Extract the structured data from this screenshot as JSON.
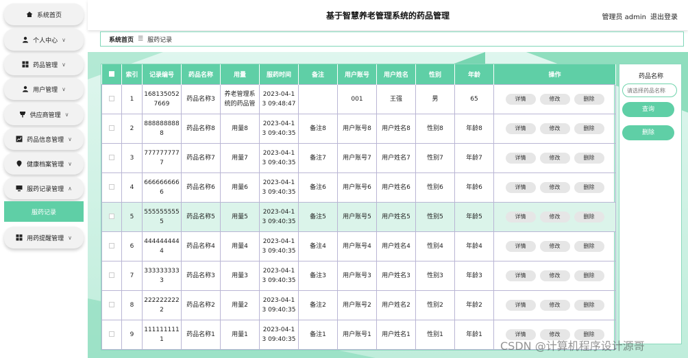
{
  "header": {
    "title": "基于智慧养老管理系统的药品管理",
    "user": "管理员 admin",
    "logout": "退出登录"
  },
  "breadcrumb": {
    "home": "系统首页",
    "separator": "☰",
    "current": "服药记录"
  },
  "sidebar": {
    "items": [
      {
        "label": "系统首页",
        "icon": "home-icon",
        "chevron": ""
      },
      {
        "label": "个人中心",
        "icon": "person-icon",
        "chevron": "∨"
      },
      {
        "label": "药品管理",
        "icon": "grid-icon",
        "chevron": "∨"
      },
      {
        "label": "用户管理",
        "icon": "person-icon",
        "chevron": "∨"
      },
      {
        "label": "供应商管理",
        "icon": "pin-icon",
        "chevron": "∨"
      },
      {
        "label": "药品信息管理",
        "icon": "chart-icon",
        "chevron": "∨"
      },
      {
        "label": "健康档案管理",
        "icon": "location-icon",
        "chevron": "∨"
      },
      {
        "label": "服药记录管理",
        "icon": "monitor-icon",
        "chevron": "∧"
      },
      {
        "label": "用药提醒管理",
        "icon": "grid-icon",
        "chevron": "∨"
      }
    ],
    "sub_item": "服药记录"
  },
  "table": {
    "headers": [
      "索引",
      "记录编号",
      "药品名称",
      "用量",
      "服药时间",
      "备注",
      "用户账号",
      "用户姓名",
      "性别",
      "年龄",
      "操作"
    ],
    "actions": {
      "detail": "详情",
      "edit": "修改",
      "delete": "删除"
    },
    "rows": [
      {
        "index": "1",
        "record_no": "1681350527669",
        "drug": "药品名称3",
        "dosage": "养老管理系统的药品管",
        "time": "2023-04-13 09:48:47",
        "note": "",
        "account": "001",
        "name": "王强",
        "gender": "男",
        "age": "65"
      },
      {
        "index": "2",
        "record_no": "8888888888",
        "drug": "药品名称8",
        "dosage": "用量8",
        "time": "2023-04-13 09:40:35",
        "note": "备注8",
        "account": "用户账号8",
        "name": "用户姓名8",
        "gender": "性别8",
        "age": "年龄8"
      },
      {
        "index": "3",
        "record_no": "7777777777",
        "drug": "药品名称7",
        "dosage": "用量7",
        "time": "2023-04-13 09:40:35",
        "note": "备注7",
        "account": "用户账号7",
        "name": "用户姓名7",
        "gender": "性别7",
        "age": "年龄7"
      },
      {
        "index": "4",
        "record_no": "6666666666",
        "drug": "药品名称6",
        "dosage": "用量6",
        "time": "2023-04-13 09:40:35",
        "note": "备注6",
        "account": "用户账号6",
        "name": "用户姓名6",
        "gender": "性别6",
        "age": "年龄6"
      },
      {
        "index": "5",
        "record_no": "5555555555",
        "drug": "药品名称5",
        "dosage": "用量5",
        "time": "2023-04-13 09:40:35",
        "note": "备注5",
        "account": "用户账号5",
        "name": "用户姓名5",
        "gender": "性别5",
        "age": "年龄5"
      },
      {
        "index": "6",
        "record_no": "4444444444",
        "drug": "药品名称4",
        "dosage": "用量4",
        "time": "2023-04-13 09:40:35",
        "note": "备注4",
        "account": "用户账号4",
        "name": "用户姓名4",
        "gender": "性别4",
        "age": "年龄4"
      },
      {
        "index": "7",
        "record_no": "3333333333",
        "drug": "药品名称3",
        "dosage": "用量3",
        "time": "2023-04-13 09:40:35",
        "note": "备注3",
        "account": "用户账号3",
        "name": "用户姓名3",
        "gender": "性别3",
        "age": "年龄3"
      },
      {
        "index": "8",
        "record_no": "2222222222",
        "drug": "药品名称2",
        "dosage": "用量2",
        "time": "2023-04-13 09:40:35",
        "note": "备注2",
        "account": "用户账号2",
        "name": "用户姓名2",
        "gender": "性别2",
        "age": "年龄2"
      },
      {
        "index": "9",
        "record_no": "1111111111",
        "drug": "药品名称1",
        "dosage": "用量1",
        "time": "2023-04-13 09:40:35",
        "note": "备注1",
        "account": "用户账号1",
        "name": "用户姓名1",
        "gender": "性别1",
        "age": "年龄1"
      }
    ]
  },
  "search": {
    "label": "药品名称",
    "placeholder": "请选择药品名称",
    "query_button": "查询",
    "delete_button": "删除"
  },
  "watermark": "CSDN @计算机程序设计源哥",
  "colors": {
    "accent": "#5fcfa6",
    "highlight_row": "#dbf4ea"
  }
}
